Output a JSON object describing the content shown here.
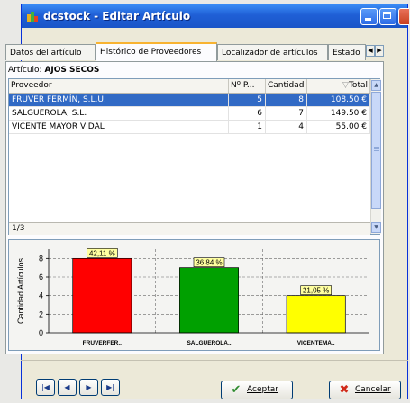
{
  "window": {
    "title": "dcstock - Editar Artículo"
  },
  "tabs": [
    {
      "label": "Datos del artículo"
    },
    {
      "label": "Histórico de Proveedores"
    },
    {
      "label": "Localizador de artículos"
    },
    {
      "label": "Estado"
    }
  ],
  "article": {
    "label": "Artículo:",
    "name": "AJOS SECOS"
  },
  "grid": {
    "columns": [
      "Proveedor",
      "Nº P...",
      "Cantidad",
      "Total"
    ],
    "rows": [
      {
        "proveedor": "FRUVER FERMÍN, S.L.U.",
        "pedidos": "5",
        "cantidad": "8",
        "total": "108.50 €"
      },
      {
        "proveedor": "SALGUEROLA, S.L.",
        "pedidos": "6",
        "cantidad": "7",
        "total": "149.50 €"
      },
      {
        "proveedor": "VICENTE MAYOR VIDAL",
        "pedidos": "1",
        "cantidad": "4",
        "total": "55.00 €"
      }
    ],
    "selected_row": 0,
    "record_indicator": "1/3"
  },
  "chart_data": {
    "type": "bar",
    "categories": [
      "FRUVERFER..",
      "SALGUEROLA..",
      "VICENTEMA.."
    ],
    "values": [
      8,
      7,
      4
    ],
    "labels": [
      "42,11 %",
      "36,84 %",
      "21,05 %"
    ],
    "colors": [
      "#ff0000",
      "#00a000",
      "#ffff00"
    ],
    "ylabel": "Cantidad Artículos",
    "yticks": [
      "0",
      "2",
      "4",
      "6",
      "8"
    ],
    "ylim": [
      0,
      9
    ],
    "grid": true
  },
  "footer": {
    "accept_label": "Aceptar",
    "cancel_label": "Cancelar"
  }
}
